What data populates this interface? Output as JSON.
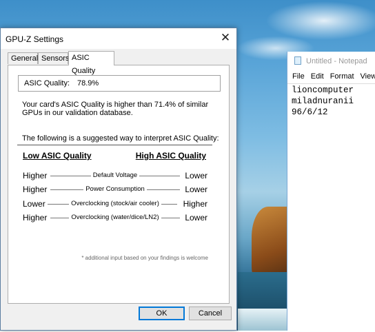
{
  "gpuz": {
    "title": "GPU-Z Settings",
    "close": "✕",
    "tabs": [
      {
        "label": "General",
        "active": false
      },
      {
        "label": "Sensors",
        "active": false
      },
      {
        "label": "ASIC Quality",
        "active": true
      }
    ],
    "asic_label": "ASIC Quality:",
    "asic_value": "78.9%",
    "description": "Your card's ASIC Quality is higher than 71.4% of similar GPUs in our validation database.",
    "suggest_text": "The following is a suggested way to interpret ASIC Quality:",
    "low_header": "Low ASIC Quality",
    "high_header": "High ASIC Quality",
    "rows": [
      {
        "left": "Higher",
        "middle": "Default Voltage",
        "right": "Lower"
      },
      {
        "left": "Higher",
        "middle": "Power Consumption",
        "right": "Lower"
      },
      {
        "left": "Lower",
        "middle": "Overclocking (stock/air cooler)",
        "right": "Higher"
      },
      {
        "left": "Higher",
        "middle": "Overclocking (water/dice/LN2)",
        "right": "Lower"
      }
    ],
    "note": "* additional input based on your findings is welcome",
    "ok_label": "OK",
    "cancel_label": "Cancel"
  },
  "notepad": {
    "title": "Untitled - Notepad",
    "menu": [
      "File",
      "Edit",
      "Format",
      "View"
    ],
    "lines": [
      "lioncomputer",
      "miladnuranii",
      "96/6/12"
    ]
  },
  "colors": {
    "window_border": "#5b7ea1",
    "ok_focus": "#0078d7",
    "dialog_bg": "#f0f0f0"
  }
}
